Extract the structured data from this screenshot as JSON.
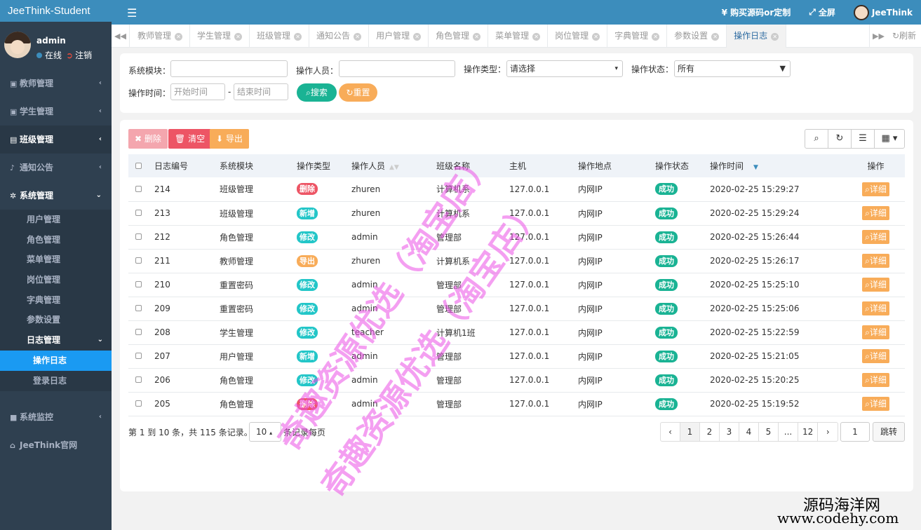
{
  "brand": "JeeThink-Student",
  "user": {
    "name": "admin",
    "status": "在线",
    "logout": "注销"
  },
  "menu": {
    "teacher": "教师管理",
    "student": "学生管理",
    "class": "班级管理",
    "notice": "通知公告",
    "system": "系统管理",
    "system_sub": [
      "用户管理",
      "角色管理",
      "菜单管理",
      "岗位管理",
      "字典管理",
      "参数设置"
    ],
    "log": "日志管理",
    "log_sub": [
      "操作日志",
      "登录日志"
    ],
    "monitor": "系统监控",
    "website": "JeeThink官网"
  },
  "header": {
    "buy": "¥ 购买源码or定制",
    "fullscreen": "全屏",
    "user": "JeeThink"
  },
  "tabs": [
    "教师管理",
    "学生管理",
    "班级管理",
    "通知公告",
    "用户管理",
    "角色管理",
    "菜单管理",
    "岗位管理",
    "字典管理",
    "参数设置",
    "操作日志"
  ],
  "refresh_label": "刷新",
  "search": {
    "module_label": "系统模块：",
    "operator_label": "操作人员：",
    "type_label": "操作类型：",
    "type_value": "请选择",
    "status_label": "操作状态：",
    "status_value": "所有",
    "time_label": "操作时间：",
    "start_placeholder": "开始时间",
    "dash": "-",
    "end_placeholder": "结束时间",
    "search_btn": "搜索",
    "reset_btn": "重置"
  },
  "toolbar": {
    "delete": "删除",
    "clear": "清空",
    "export": "导出"
  },
  "columns": [
    "日志编号",
    "系统模块",
    "操作类型",
    "操作人员",
    "班级名称",
    "主机",
    "操作地点",
    "操作状态",
    "操作时间",
    "操作"
  ],
  "rows": [
    {
      "id": "214",
      "module": "班级管理",
      "type": "删除",
      "type_kind": "del",
      "op": "zhuren",
      "class": "计算机系",
      "host": "127.0.0.1",
      "loc": "内网IP",
      "status": "成功",
      "time": "2020-02-25 15:29:27",
      "action": "详细"
    },
    {
      "id": "213",
      "module": "班级管理",
      "type": "新增",
      "type_kind": "add",
      "op": "zhuren",
      "class": "计算机系",
      "host": "127.0.0.1",
      "loc": "内网IP",
      "status": "成功",
      "time": "2020-02-25 15:29:24",
      "action": "详细"
    },
    {
      "id": "212",
      "module": "角色管理",
      "type": "修改",
      "type_kind": "mod",
      "op": "admin",
      "class": "管理部",
      "host": "127.0.0.1",
      "loc": "内网IP",
      "status": "成功",
      "time": "2020-02-25 15:26:44",
      "action": "详细"
    },
    {
      "id": "211",
      "module": "教师管理",
      "type": "导出",
      "type_kind": "exp",
      "op": "zhuren",
      "class": "计算机系",
      "host": "127.0.0.1",
      "loc": "内网IP",
      "status": "成功",
      "time": "2020-02-25 15:26:17",
      "action": "详细"
    },
    {
      "id": "210",
      "module": "重置密码",
      "type": "修改",
      "type_kind": "mod",
      "op": "admin",
      "class": "管理部",
      "host": "127.0.0.1",
      "loc": "内网IP",
      "status": "成功",
      "time": "2020-02-25 15:25:10",
      "action": "详细"
    },
    {
      "id": "209",
      "module": "重置密码",
      "type": "修改",
      "type_kind": "mod",
      "op": "admin",
      "class": "管理部",
      "host": "127.0.0.1",
      "loc": "内网IP",
      "status": "成功",
      "time": "2020-02-25 15:25:06",
      "action": "详细"
    },
    {
      "id": "208",
      "module": "学生管理",
      "type": "修改",
      "type_kind": "mod",
      "op": "teacher",
      "class": "计算机1班",
      "host": "127.0.0.1",
      "loc": "内网IP",
      "status": "成功",
      "time": "2020-02-25 15:22:59",
      "action": "详细"
    },
    {
      "id": "207",
      "module": "用户管理",
      "type": "新增",
      "type_kind": "add",
      "op": "admin",
      "class": "管理部",
      "host": "127.0.0.1",
      "loc": "内网IP",
      "status": "成功",
      "time": "2020-02-25 15:21:05",
      "action": "详细"
    },
    {
      "id": "206",
      "module": "角色管理",
      "type": "修改",
      "type_kind": "mod",
      "op": "admin",
      "class": "管理部",
      "host": "127.0.0.1",
      "loc": "内网IP",
      "status": "成功",
      "time": "2020-02-25 15:20:25",
      "action": "详细"
    },
    {
      "id": "205",
      "module": "角色管理",
      "type": "删除",
      "type_kind": "del",
      "op": "admin",
      "class": "管理部",
      "host": "127.0.0.1",
      "loc": "内网IP",
      "status": "成功",
      "time": "2020-02-25 15:19:52",
      "action": "详细"
    }
  ],
  "pager": {
    "info": "第 1 到 10 条，共 115 条记录。",
    "per_page": "10",
    "per_page_label": "条记录每页",
    "pages": [
      "‹",
      "1",
      "2",
      "3",
      "4",
      "5",
      "...",
      "12",
      "›"
    ],
    "jump_value": "1",
    "jump_btn": "跳转"
  },
  "watermarks": {
    "line1": "奇趣资源优选（淘宝店）",
    "line2": "奇趣资源优选（淘宝店）",
    "site_cn": "源码海洋网",
    "site_url": "www.codehy.com"
  },
  "colors": {
    "sidebar": "#2f4050",
    "header": "#3c8dbc",
    "active_menu": "#1a9af2",
    "delete": "#ed5565",
    "add": "#23c6c8",
    "export": "#f8ac59",
    "success": "#1ab394"
  }
}
